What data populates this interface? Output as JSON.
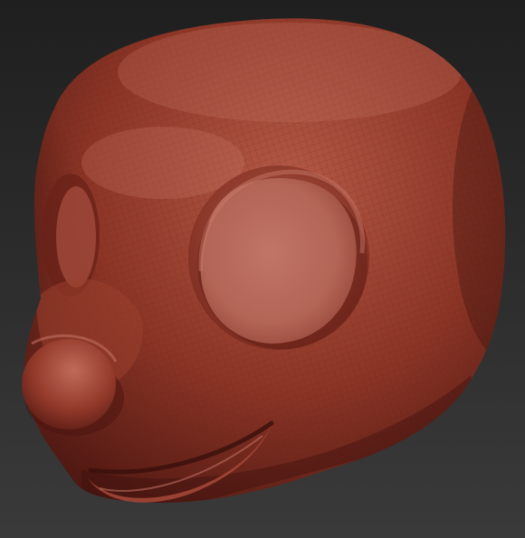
{
  "scene": {
    "subject": "sculpted-head-render",
    "colors": {
      "background_top": "#1f1f1f",
      "background_bottom": "#3a3a3a",
      "clay_base": "#8c3526",
      "clay_mid": "#a84a38",
      "clay_light": "#c77666",
      "clay_dark": "#4f1812",
      "eye_fill": "#b56a5c",
      "mesh_line": "#6f2a20"
    }
  }
}
